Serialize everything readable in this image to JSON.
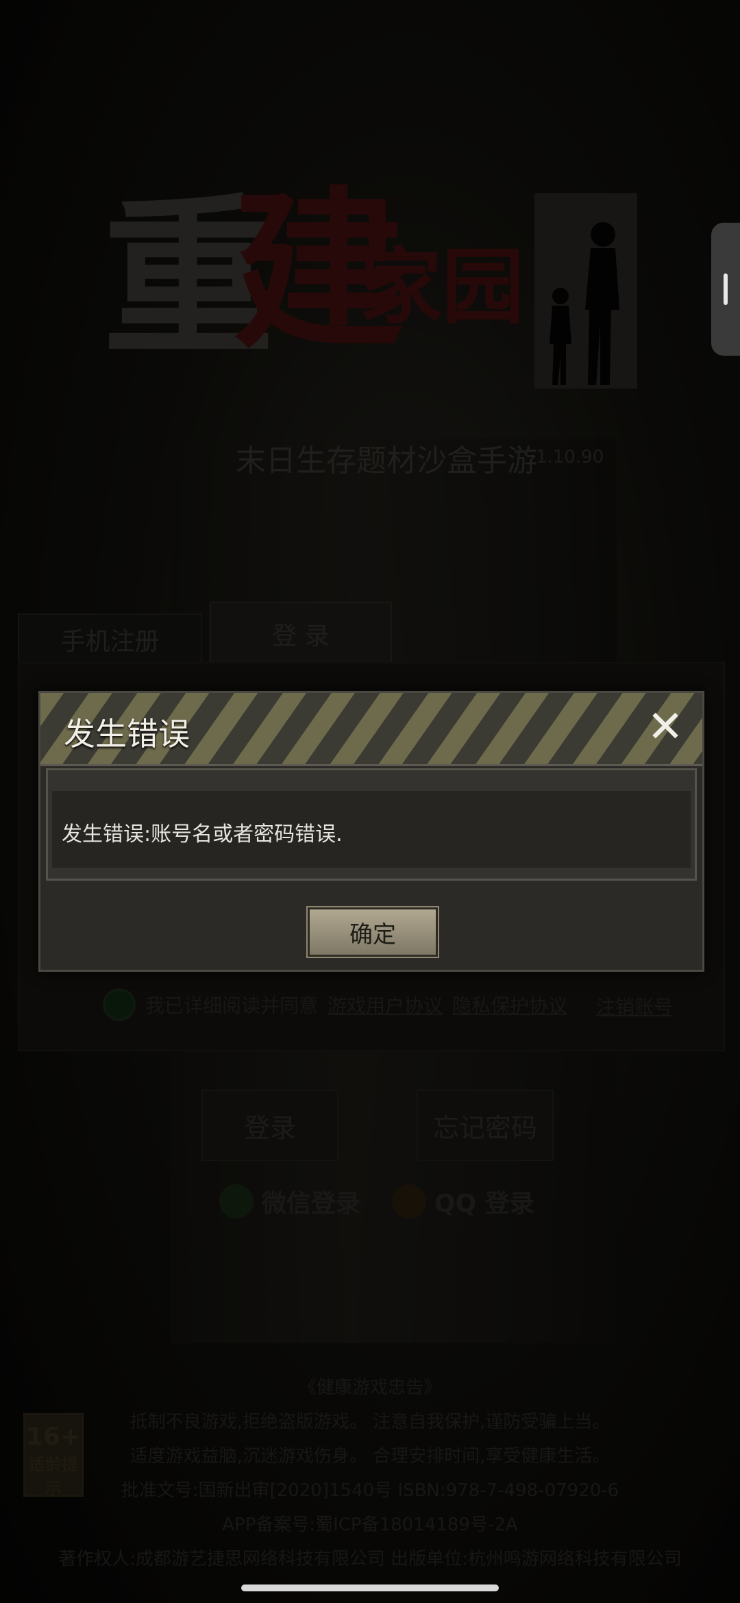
{
  "logo": {
    "title_char1": "重",
    "title_char2": "建",
    "title_small": "家园",
    "subtitle": "末日生存题材沙盒手游",
    "version": "1.10.90"
  },
  "login_panel": {
    "tabs": [
      {
        "label": "手机注册"
      },
      {
        "label": "登 录"
      }
    ],
    "agreement_text": "我已详细阅读并同意",
    "user_agreement_link": "游戏用户协议",
    "privacy_link": "隐私保护协议",
    "cancel_account_link": "注销账号",
    "login_button": "登录",
    "forgot_button": "忘记密码",
    "wechat_login": "微信登录",
    "qq_login": "QQ 登录"
  },
  "dialog": {
    "title": "发生错误",
    "message": "发生错误:账号名或者密码错误.",
    "confirm_label": "确定",
    "close_symbol": "✕"
  },
  "footer": {
    "notice_title": "《健康游戏忠告》",
    "line1": "抵制不良游戏,拒绝盗版游戏。 注意自我保护,谨防受骗上当。",
    "line2": "适度游戏益脑,沉迷游戏伤身。 合理安排时间,享受健康生活。",
    "line3": "批准文号:国新出审[2020]1540号 ISBN:978-7-498-07920-6",
    "line4": "APP备案号:蜀ICP备18014189号-2A",
    "line5": "著作权人:成都游艺捷思网络科技有限公司 出版单位:杭州鸣游网络科技有限公司",
    "age_rating": "16+",
    "age_label": "适龄提示"
  },
  "colors": {
    "dialog_bg": "#2b2a26",
    "hazard_yellow": "#6e6a4c",
    "button_tan": "#b0a890"
  }
}
